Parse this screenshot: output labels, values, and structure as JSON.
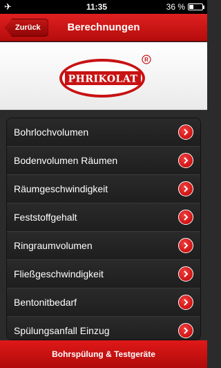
{
  "status_bar": {
    "time": "11:35",
    "battery_text": "36 %",
    "battery_level": 0.36,
    "airplane_icon": "airplane-icon"
  },
  "navbar": {
    "back_label": "Zurück",
    "title": "Berechnungen"
  },
  "logo": {
    "text": "PHRIKOLAT",
    "registered": "®"
  },
  "list": {
    "items": [
      {
        "label": "Bohrlochvolumen"
      },
      {
        "label": "Bodenvolumen Räumen"
      },
      {
        "label": "Räumgeschwindigkeit"
      },
      {
        "label": "Feststoffgehalt"
      },
      {
        "label": "Ringraumvolumen"
      },
      {
        "label": "Fließgeschwindigkeit"
      },
      {
        "label": "Bentonitbedarf"
      },
      {
        "label": "Spülungsanfall Einzug"
      }
    ]
  },
  "bottom_bar": {
    "label": "Bohrspülung & Testgeräte"
  },
  "colors": {
    "accent": "#d41414",
    "list_bg": "#1f1f1f"
  }
}
